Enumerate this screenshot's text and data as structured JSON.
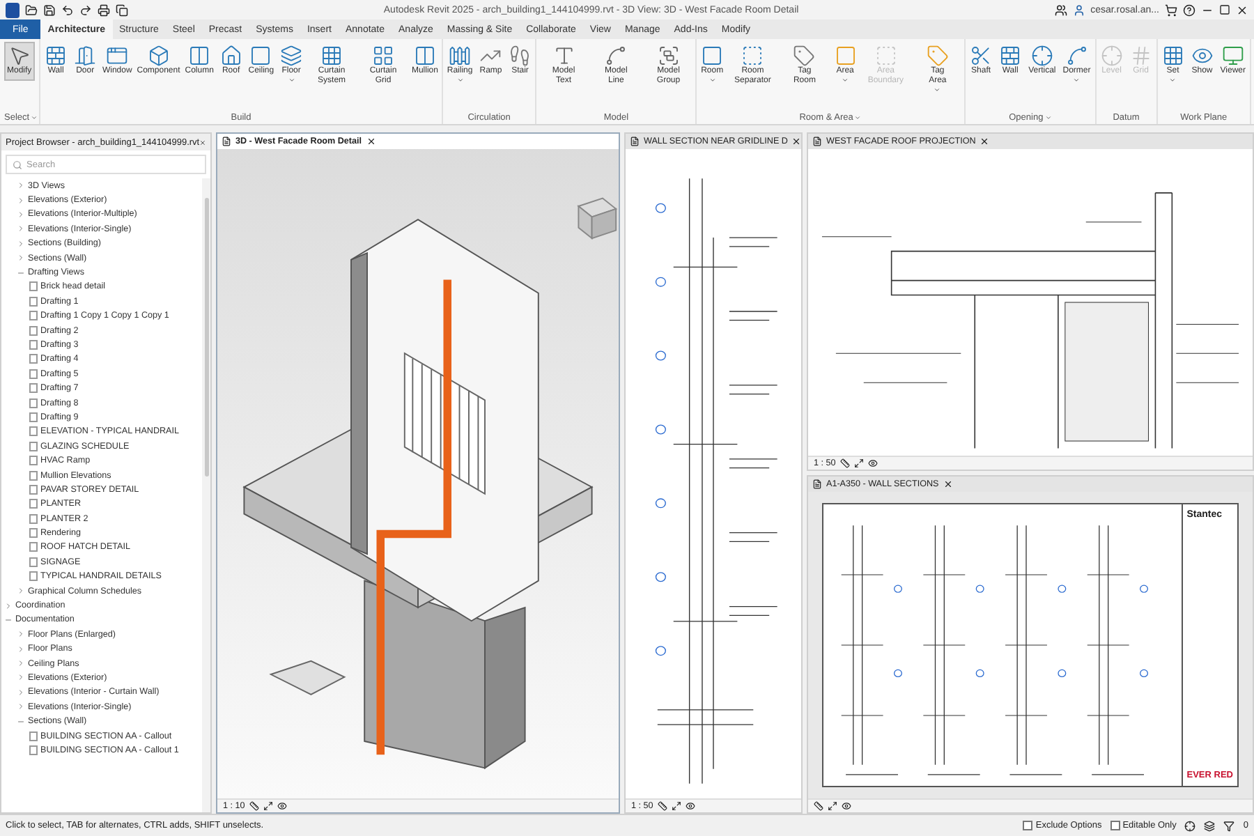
{
  "window": {
    "title": "Autodesk Revit 2025 - arch_building1_144104999.rvt - 3D View: 3D - West Facade Room Detail",
    "user": "cesar.rosal.an..."
  },
  "menu_tabs": [
    {
      "label": "File",
      "kind": "file",
      "selected": false
    },
    {
      "label": "Architecture",
      "kind": "tab",
      "selected": true
    },
    {
      "label": "Structure",
      "kind": "tab",
      "selected": false
    },
    {
      "label": "Steel",
      "kind": "tab",
      "selected": false
    },
    {
      "label": "Precast",
      "kind": "tab",
      "selected": false
    },
    {
      "label": "Systems",
      "kind": "tab",
      "selected": false
    },
    {
      "label": "Insert",
      "kind": "tab",
      "selected": false
    },
    {
      "label": "Annotate",
      "kind": "tab",
      "selected": false
    },
    {
      "label": "Analyze",
      "kind": "tab",
      "selected": false
    },
    {
      "label": "Massing & Site",
      "kind": "tab",
      "selected": false
    },
    {
      "label": "Collaborate",
      "kind": "tab",
      "selected": false
    },
    {
      "label": "View",
      "kind": "tab",
      "selected": false
    },
    {
      "label": "Manage",
      "kind": "tab",
      "selected": false
    },
    {
      "label": "Add-Ins",
      "kind": "tab",
      "selected": false
    },
    {
      "label": "Modify",
      "kind": "tab",
      "selected": false
    }
  ],
  "ribbon": [
    {
      "title": "Select",
      "has_menu": true,
      "buttons": [
        {
          "label": "Modify",
          "active": true,
          "disabled": false,
          "has_menu": false
        }
      ]
    },
    {
      "title": "Build",
      "has_menu": false,
      "buttons": [
        {
          "label": "Wall",
          "active": false,
          "disabled": false,
          "has_menu": false
        },
        {
          "label": "Door",
          "active": false,
          "disabled": false,
          "has_menu": false
        },
        {
          "label": "Window",
          "active": false,
          "disabled": false,
          "has_menu": false
        },
        {
          "label": "Component",
          "active": false,
          "disabled": false,
          "has_menu": false
        },
        {
          "label": "Column",
          "active": false,
          "disabled": false,
          "has_menu": false
        },
        {
          "label": "Roof",
          "active": false,
          "disabled": false,
          "has_menu": false
        },
        {
          "label": "Ceiling",
          "active": false,
          "disabled": false,
          "has_menu": false
        },
        {
          "label": "Floor",
          "active": false,
          "disabled": false,
          "has_menu": true
        },
        {
          "label": "Curtain System",
          "active": false,
          "disabled": false,
          "has_menu": false
        },
        {
          "label": "Curtain Grid",
          "active": false,
          "disabled": false,
          "has_menu": false
        },
        {
          "label": "Mullion",
          "active": false,
          "disabled": false,
          "has_menu": false
        }
      ]
    },
    {
      "title": "Circulation",
      "has_menu": false,
      "buttons": [
        {
          "label": "Railing",
          "active": false,
          "disabled": false,
          "has_menu": true
        },
        {
          "label": "Ramp",
          "active": false,
          "disabled": false,
          "has_menu": false
        },
        {
          "label": "Stair",
          "active": false,
          "disabled": false,
          "has_menu": false
        }
      ]
    },
    {
      "title": "Model",
      "has_menu": false,
      "buttons": [
        {
          "label": "Model Text",
          "active": false,
          "disabled": false,
          "has_menu": false
        },
        {
          "label": "Model Line",
          "active": false,
          "disabled": false,
          "has_menu": false
        },
        {
          "label": "Model Group",
          "active": false,
          "disabled": false,
          "has_menu": false
        }
      ]
    },
    {
      "title": "Room & Area",
      "has_menu": true,
      "buttons": [
        {
          "label": "Room",
          "active": false,
          "disabled": false,
          "has_menu": true
        },
        {
          "label": "Room Separator",
          "active": false,
          "disabled": false,
          "has_menu": false
        },
        {
          "label": "Tag Room",
          "active": false,
          "disabled": false,
          "has_menu": false
        },
        {
          "label": "Area",
          "active": false,
          "disabled": false,
          "has_menu": true
        },
        {
          "label": "Area Boundary",
          "active": false,
          "disabled": true,
          "has_menu": false
        },
        {
          "label": "Tag Area",
          "active": false,
          "disabled": false,
          "has_menu": true
        }
      ]
    },
    {
      "title": "Opening",
      "has_menu": true,
      "buttons": [
        {
          "label": "Shaft",
          "active": false,
          "disabled": false,
          "has_menu": false
        },
        {
          "label": "Wall",
          "active": false,
          "disabled": false,
          "has_menu": false
        },
        {
          "label": "Vertical",
          "active": false,
          "disabled": false,
          "has_menu": false
        },
        {
          "label": "Dormer",
          "active": false,
          "disabled": false,
          "has_menu": true
        }
      ]
    },
    {
      "title": "Datum",
      "has_menu": false,
      "buttons": [
        {
          "label": "Level",
          "active": false,
          "disabled": true,
          "has_menu": false
        },
        {
          "label": "Grid",
          "active": false,
          "disabled": true,
          "has_menu": false
        }
      ]
    },
    {
      "title": "Work Plane",
      "has_menu": false,
      "buttons": [
        {
          "label": "Set",
          "active": false,
          "disabled": false,
          "has_menu": true
        },
        {
          "label": "Show",
          "active": false,
          "disabled": false,
          "has_menu": false
        },
        {
          "label": "Viewer",
          "active": false,
          "disabled": false,
          "has_menu": false
        }
      ]
    }
  ],
  "project_browser": {
    "title": "Project Browser - arch_building1_144104999.rvt",
    "search": {
      "placeholder": "Search"
    },
    "continued": [
      {
        "label": "3D Views",
        "kind": "group",
        "expanded": false
      },
      {
        "label": "Elevations (Exterior)",
        "kind": "group",
        "expanded": false
      },
      {
        "label": "Elevations (Interior-Multiple)",
        "kind": "group",
        "expanded": false
      },
      {
        "label": "Elevations (Interior-Single)",
        "kind": "group",
        "expanded": false
      },
      {
        "label": "Sections (Building)",
        "kind": "group",
        "expanded": false
      },
      {
        "label": "Sections (Wall)",
        "kind": "group",
        "expanded": false
      },
      {
        "label": "Drafting Views",
        "kind": "group",
        "expanded": true,
        "children": [
          {
            "label": "Brick head detail",
            "kind": "view"
          },
          {
            "label": "Drafting 1",
            "kind": "view"
          },
          {
            "label": "Drafting 1 Copy 1 Copy 1 Copy 1",
            "kind": "view"
          },
          {
            "label": "Drafting 2",
            "kind": "view"
          },
          {
            "label": "Drafting 3",
            "kind": "view"
          },
          {
            "label": "Drafting 4",
            "kind": "view"
          },
          {
            "label": "Drafting 5",
            "kind": "view"
          },
          {
            "label": "Drafting 7",
            "kind": "view"
          },
          {
            "label": "Drafting 8",
            "kind": "view"
          },
          {
            "label": "Drafting 9",
            "kind": "view"
          },
          {
            "label": "ELEVATION - TYPICAL HANDRAIL",
            "kind": "view"
          },
          {
            "label": "GLAZING SCHEDULE",
            "kind": "view"
          },
          {
            "label": "HVAC Ramp",
            "kind": "view"
          },
          {
            "label": "Mullion Elevations",
            "kind": "view"
          },
          {
            "label": "PAVAR STOREY DETAIL",
            "kind": "view"
          },
          {
            "label": "PLANTER",
            "kind": "view"
          },
          {
            "label": "PLANTER 2",
            "kind": "view"
          },
          {
            "label": "Rendering",
            "kind": "view"
          },
          {
            "label": "ROOF HATCH DETAIL",
            "kind": "view"
          },
          {
            "label": "SIGNAGE",
            "kind": "view"
          },
          {
            "label": "TYPICAL HANDRAIL DETAILS",
            "kind": "view"
          }
        ]
      },
      {
        "label": "Graphical Column Schedules",
        "kind": "group",
        "expanded": false
      }
    ],
    "items": [
      {
        "label": "Coordination",
        "kind": "group",
        "expanded": false
      },
      {
        "label": "Documentation",
        "kind": "group",
        "expanded": true,
        "children": [
          {
            "label": "Floor Plans (Enlarged)",
            "kind": "group",
            "expanded": false
          },
          {
            "label": "Floor Plans",
            "kind": "group",
            "expanded": false
          },
          {
            "label": "Ceiling Plans",
            "kind": "group",
            "expanded": false
          },
          {
            "label": "Elevations (Exterior)",
            "kind": "group",
            "expanded": false
          },
          {
            "label": "Elevations (Interior - Curtain Wall)",
            "kind": "group",
            "expanded": false
          },
          {
            "label": "Elevations (Interior-Single)",
            "kind": "group",
            "expanded": false
          },
          {
            "label": "Sections (Wall)",
            "kind": "group",
            "expanded": true,
            "children": [
              {
                "label": "BUILDING SECTION AA - Callout",
                "kind": "view"
              },
              {
                "label": "BUILDING SECTION AA - Callout 1",
                "kind": "view"
              }
            ]
          }
        ]
      }
    ]
  },
  "views": [
    {
      "title": "3D - West Facade Room Detail",
      "kind": "model",
      "scale": "1 : 10",
      "selected": true
    },
    {
      "title": "WALL SECTION NEAR GRIDLINE D",
      "kind": "section",
      "scale": "1 : 50",
      "selected": false
    },
    {
      "title": "WEST FACADE ROOF PROJECTION",
      "kind": "roof",
      "scale": "1 : 50",
      "selected": false
    },
    {
      "title": "A1-A350 - WALL SECTIONS",
      "kind": "sheet",
      "logo": "Stantec",
      "client": "EVER RED",
      "selected": false
    }
  ],
  "status_bar": {
    "message": "Click to select, TAB for alternates, CTRL adds, SHIFT unselects.",
    "options": [
      {
        "label": "Exclude Options",
        "checked": false
      },
      {
        "label": "Editable Only",
        "checked": false
      }
    ],
    "filter_count": "0"
  }
}
